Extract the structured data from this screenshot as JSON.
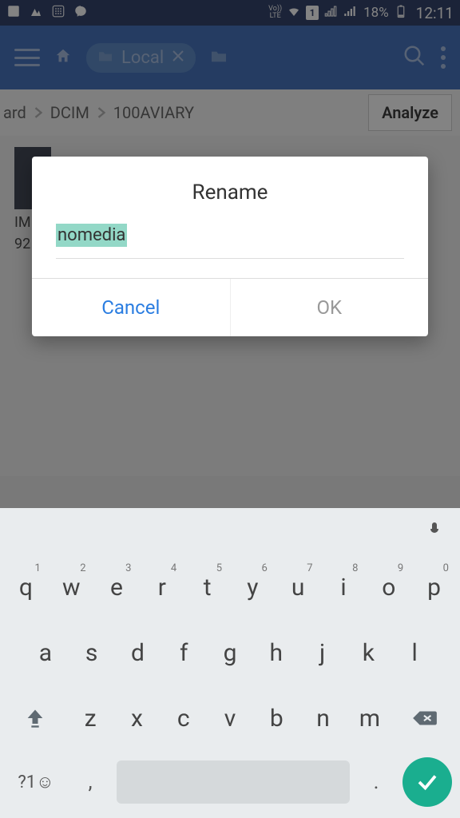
{
  "status": {
    "battery_pct": "18%",
    "time": "12:11"
  },
  "toolbar": {
    "tab_label": "Local"
  },
  "breadcrumb": {
    "crumb0": "ard",
    "crumb1": "DCIM",
    "crumb2": "100AVIARY",
    "analyze_label": "Analyze"
  },
  "file": {
    "name_part1": "IM",
    "name_part2": "92"
  },
  "dialog": {
    "title": "Rename",
    "input_value": "nomedia",
    "cancel_label": "Cancel",
    "ok_label": "OK"
  },
  "keyboard": {
    "row1": [
      {
        "k": "q",
        "n": "1"
      },
      {
        "k": "w",
        "n": "2"
      },
      {
        "k": "e",
        "n": "3"
      },
      {
        "k": "r",
        "n": "4"
      },
      {
        "k": "t",
        "n": "5"
      },
      {
        "k": "y",
        "n": "6"
      },
      {
        "k": "u",
        "n": "7"
      },
      {
        "k": "i",
        "n": "8"
      },
      {
        "k": "o",
        "n": "9"
      },
      {
        "k": "p",
        "n": "0"
      }
    ],
    "row2": [
      {
        "k": "a"
      },
      {
        "k": "s"
      },
      {
        "k": "d"
      },
      {
        "k": "f"
      },
      {
        "k": "g"
      },
      {
        "k": "h"
      },
      {
        "k": "j"
      },
      {
        "k": "k"
      },
      {
        "k": "l"
      }
    ],
    "row3": [
      {
        "k": "z"
      },
      {
        "k": "x"
      },
      {
        "k": "c"
      },
      {
        "k": "v"
      },
      {
        "k": "b"
      },
      {
        "k": "n"
      },
      {
        "k": "m"
      }
    ],
    "sym_label": "?1☺",
    "comma": ",",
    "period": "."
  }
}
